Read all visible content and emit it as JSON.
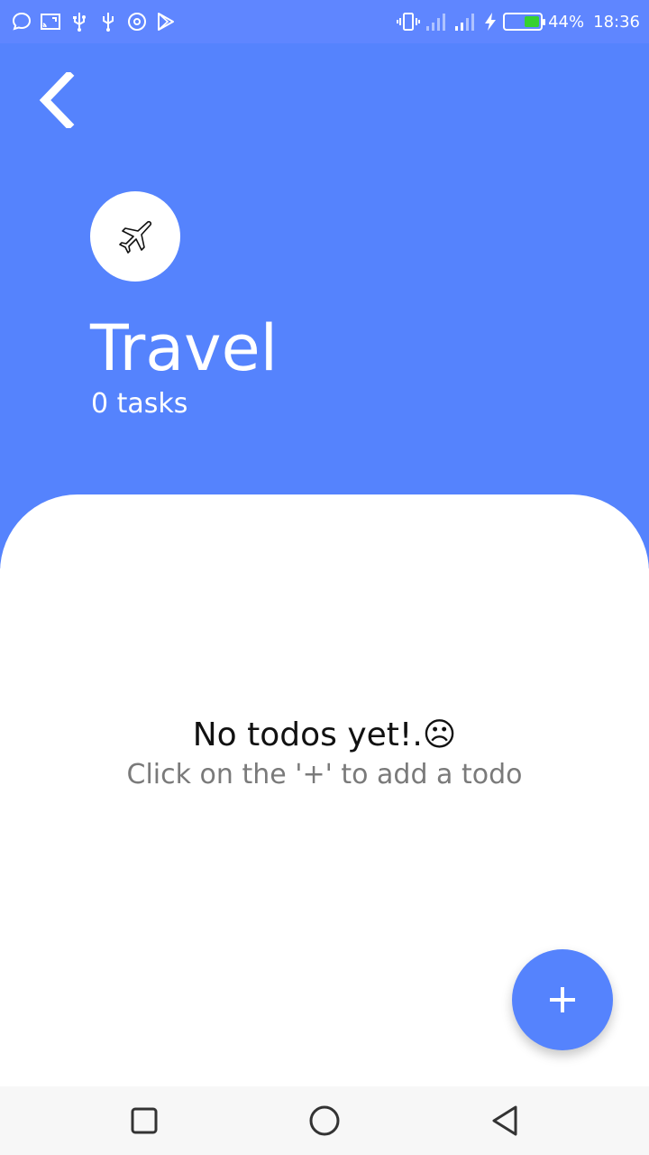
{
  "status_bar": {
    "battery_percent": "44%",
    "battery_level": 0.44,
    "battery_fill_color": "#36d12f",
    "time": "18:36",
    "left_icons": [
      "chat-bubble-icon",
      "cast-icon",
      "usb-icon",
      "usb-icon",
      "sync-icon",
      "play-store-icon"
    ],
    "right_icons": [
      "vibrate-icon",
      "signal-icon",
      "signal-icon",
      "charging-icon",
      "battery-icon"
    ]
  },
  "header": {
    "back_icon": "chevron-left-icon",
    "category_icon": "airplane-icon",
    "title": "Travel",
    "task_count": "0 tasks",
    "background_color": "#5583fd"
  },
  "empty_state": {
    "title": "No todos yet!.☹",
    "subtitle": "Click on the '+' to add a todo"
  },
  "fab": {
    "icon": "plus-icon",
    "color": "#5583fd"
  },
  "nav_bar": {
    "items": [
      "recents-square-icon",
      "home-circle-icon",
      "back-triangle-icon"
    ]
  }
}
